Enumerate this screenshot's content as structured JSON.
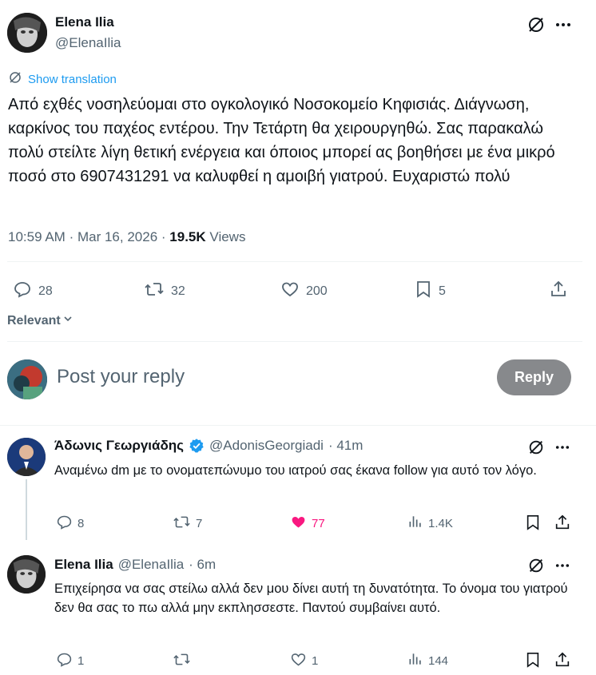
{
  "main_tweet": {
    "author_name": "Elena Ilia",
    "author_handle": "@ElenaIlia",
    "show_translation": "Show translation",
    "text": "Από εχθές νοσηλεύομαι στο ογκολογικό Νοσοκομείο Κηφισιάς. Διάγνωση, καρκίνος του παχέος εντέρου. Την Τετάρτη θα χειρουργηθώ. Σας παρακαλώ πολύ στείλτε λίγη θετική ενέργεια και όποιος μπορεί ας βοηθήσει με ένα μικρό ποσό στο 6907431291 να καλυφθεί η αμοιβή γιατρού. Ευχαριστώ πολύ",
    "time": "10:59 AM",
    "sep1": "·",
    "date": "Mar 16, 2026",
    "sep2": "·",
    "views_count": "19.5K",
    "views_label": "Views",
    "replies": "28",
    "reposts": "32",
    "likes": "200",
    "bookmarks": "5"
  },
  "sort": {
    "label": "Relevant"
  },
  "composer": {
    "placeholder": "Post your reply",
    "button": "Reply"
  },
  "replies": [
    {
      "author_name": "Άδωνις Γεωργιάδης",
      "author_handle": "@AdonisGeorgiadi",
      "time": "· 41m",
      "text": "Αναμένω dm με το ονοματεπώνυμο του ιατρού σας έκανα follow για αυτό τον λόγο.",
      "replies": "8",
      "reposts": "7",
      "likes": "77",
      "views": "1.4K",
      "liked": true
    },
    {
      "author_name": "Elena Ilia",
      "author_handle": "@ElenaIlia",
      "time": "· 6m",
      "text": "Επιχείρησα να σας στείλω αλλά δεν μου δίνει αυτή τη δυνατότητα. Το όνομα του γιατρού δεν θα σας το πω αλλά μην εκπλησσεστε. Παντού συμβαίνει αυτό.",
      "replies": "1",
      "reposts": "",
      "likes": "1",
      "views": "144",
      "liked": false
    }
  ],
  "colors": {
    "accent": "#1d9bf0",
    "like_active": "#f91880",
    "muted": "#536471",
    "reply_button": "#87898c"
  }
}
